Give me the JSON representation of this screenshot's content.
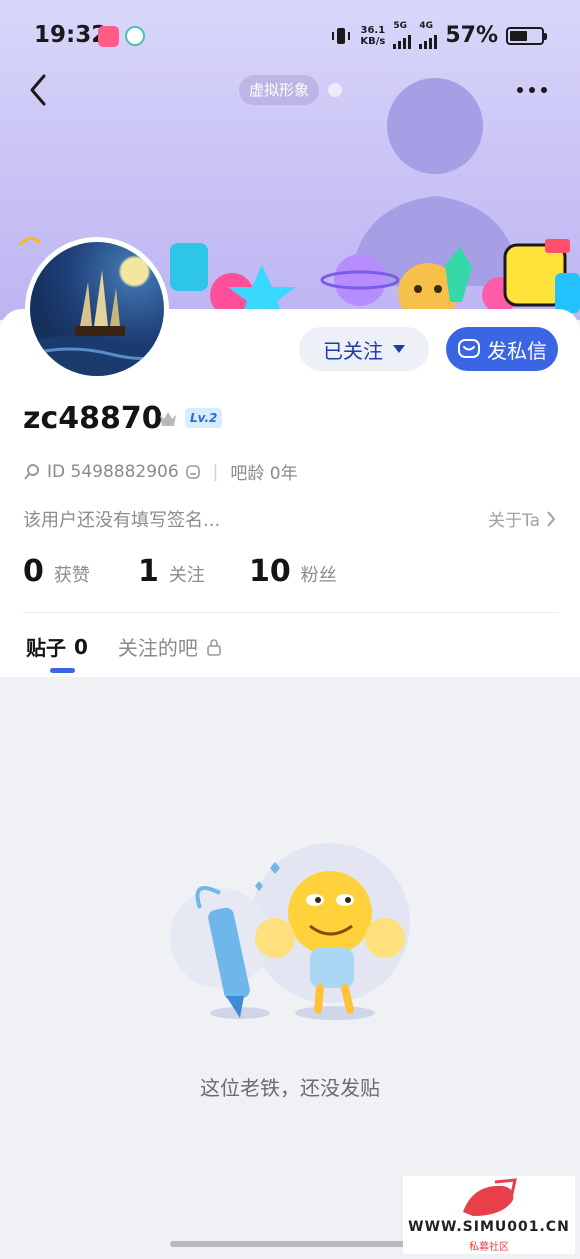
{
  "status_bar": {
    "time": "19:32",
    "net_speed_value": "36.1",
    "net_speed_unit": "KB/s",
    "signal1": "5G",
    "signal2": "4G",
    "battery": "57%",
    "battery_level": 0.57
  },
  "header": {
    "avatar_chip": "虚拟形象"
  },
  "actions": {
    "follow_label": "已关注",
    "message_label": "发私信"
  },
  "profile": {
    "username": "zc48870",
    "level": "Lv.2",
    "id_text": "ID 5498882906",
    "age_text": "吧龄 0年",
    "signature": "该用户还没有填写签名...",
    "about_label": "关于Ta"
  },
  "stats": [
    {
      "num": "0",
      "label": "获赞"
    },
    {
      "num": "1",
      "label": "关注"
    },
    {
      "num": "10",
      "label": "粉丝"
    }
  ],
  "tabs": [
    {
      "label": "贴子",
      "count": "0"
    },
    {
      "label": "关注的吧"
    }
  ],
  "empty": {
    "message": "这位老铁，还没发贴"
  },
  "watermark": {
    "text": "WWW.SIMU001.CN",
    "subtext": "私募社区"
  },
  "colors": {
    "accent": "#3a66e6",
    "banner": "#cdc8f6"
  }
}
